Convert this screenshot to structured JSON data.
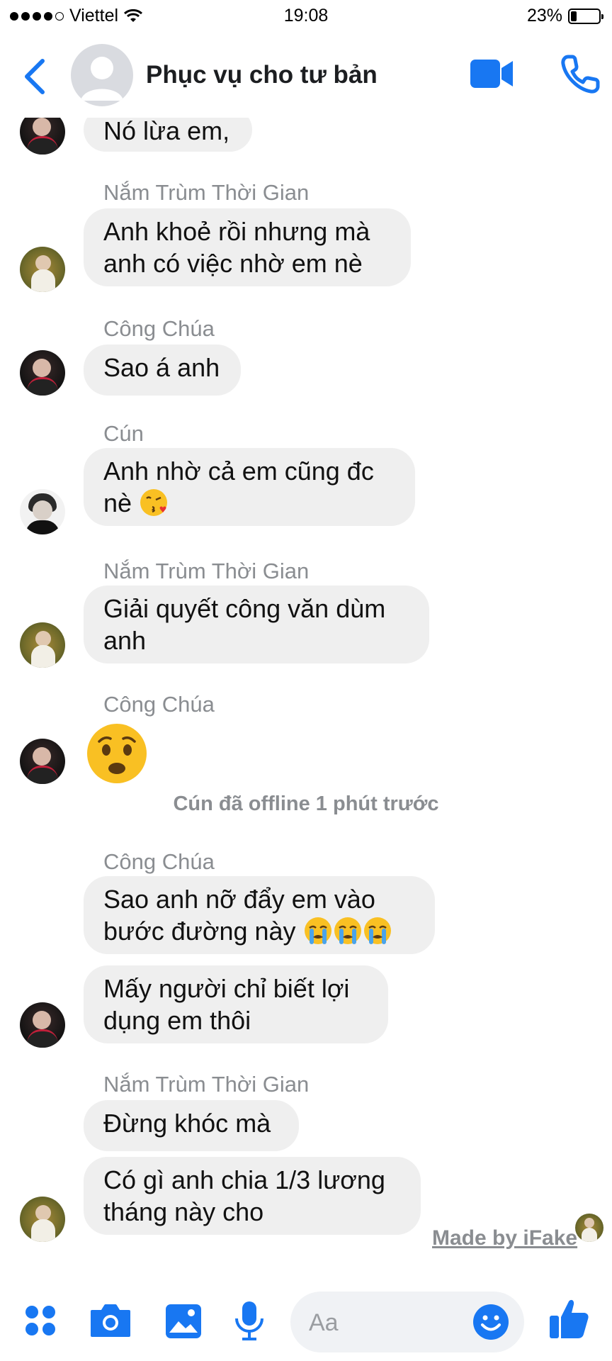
{
  "status_bar": {
    "carrier": "Viettel",
    "time": "19:08",
    "battery": "23%"
  },
  "header": {
    "title": "Phục vụ cho tư bản"
  },
  "messages": [
    {
      "sender": "",
      "lines": [
        "Nó lừa em,"
      ]
    },
    {
      "sender": "Nắm Trùm Thời Gian",
      "lines": [
        "Anh khoẻ rồi nhưng mà",
        "anh có việc nhờ em nè"
      ]
    },
    {
      "sender": "Công Chúa",
      "lines": [
        "Sao á anh"
      ]
    },
    {
      "sender": "Cún",
      "lines": [
        "Anh nhờ cả em cũng đc",
        "nè"
      ]
    },
    {
      "sender": "Nắm Trùm Thời Gian",
      "lines": [
        "Giải quyết công văn dùm",
        "anh"
      ]
    },
    {
      "sender": "Công Chúa",
      "lines": []
    },
    {
      "sender": "Công Chúa",
      "lines": [
        "Sao anh nỡ đẩy em vào",
        "bước đường này"
      ]
    },
    {
      "sender": "",
      "lines": [
        "Mấy người chỉ biết lợi",
        "dụng em thôi"
      ]
    },
    {
      "sender": "Nắm Trùm Thời Gian",
      "lines": [
        "Đừng khóc mà"
      ]
    },
    {
      "sender": "",
      "lines": [
        "Có gì anh chia 1/3 lương",
        "tháng này cho"
      ]
    }
  ],
  "system_note": "Cún đã offline 1 phút trước",
  "watermark": "Made by iFake",
  "composer": {
    "placeholder": "Aa"
  },
  "icons": {
    "back": "chevron-left-icon",
    "video": "video-camera-icon",
    "phone": "phone-icon",
    "apps": "four-dots-icon",
    "camera": "camera-icon",
    "gallery": "image-icon",
    "mic": "microphone-icon",
    "emoji": "smiley-icon",
    "like": "thumbs-up-icon"
  },
  "colors": {
    "accent": "#1877f2",
    "bubble": "#efefef",
    "muted_text": "#8a8d91"
  }
}
